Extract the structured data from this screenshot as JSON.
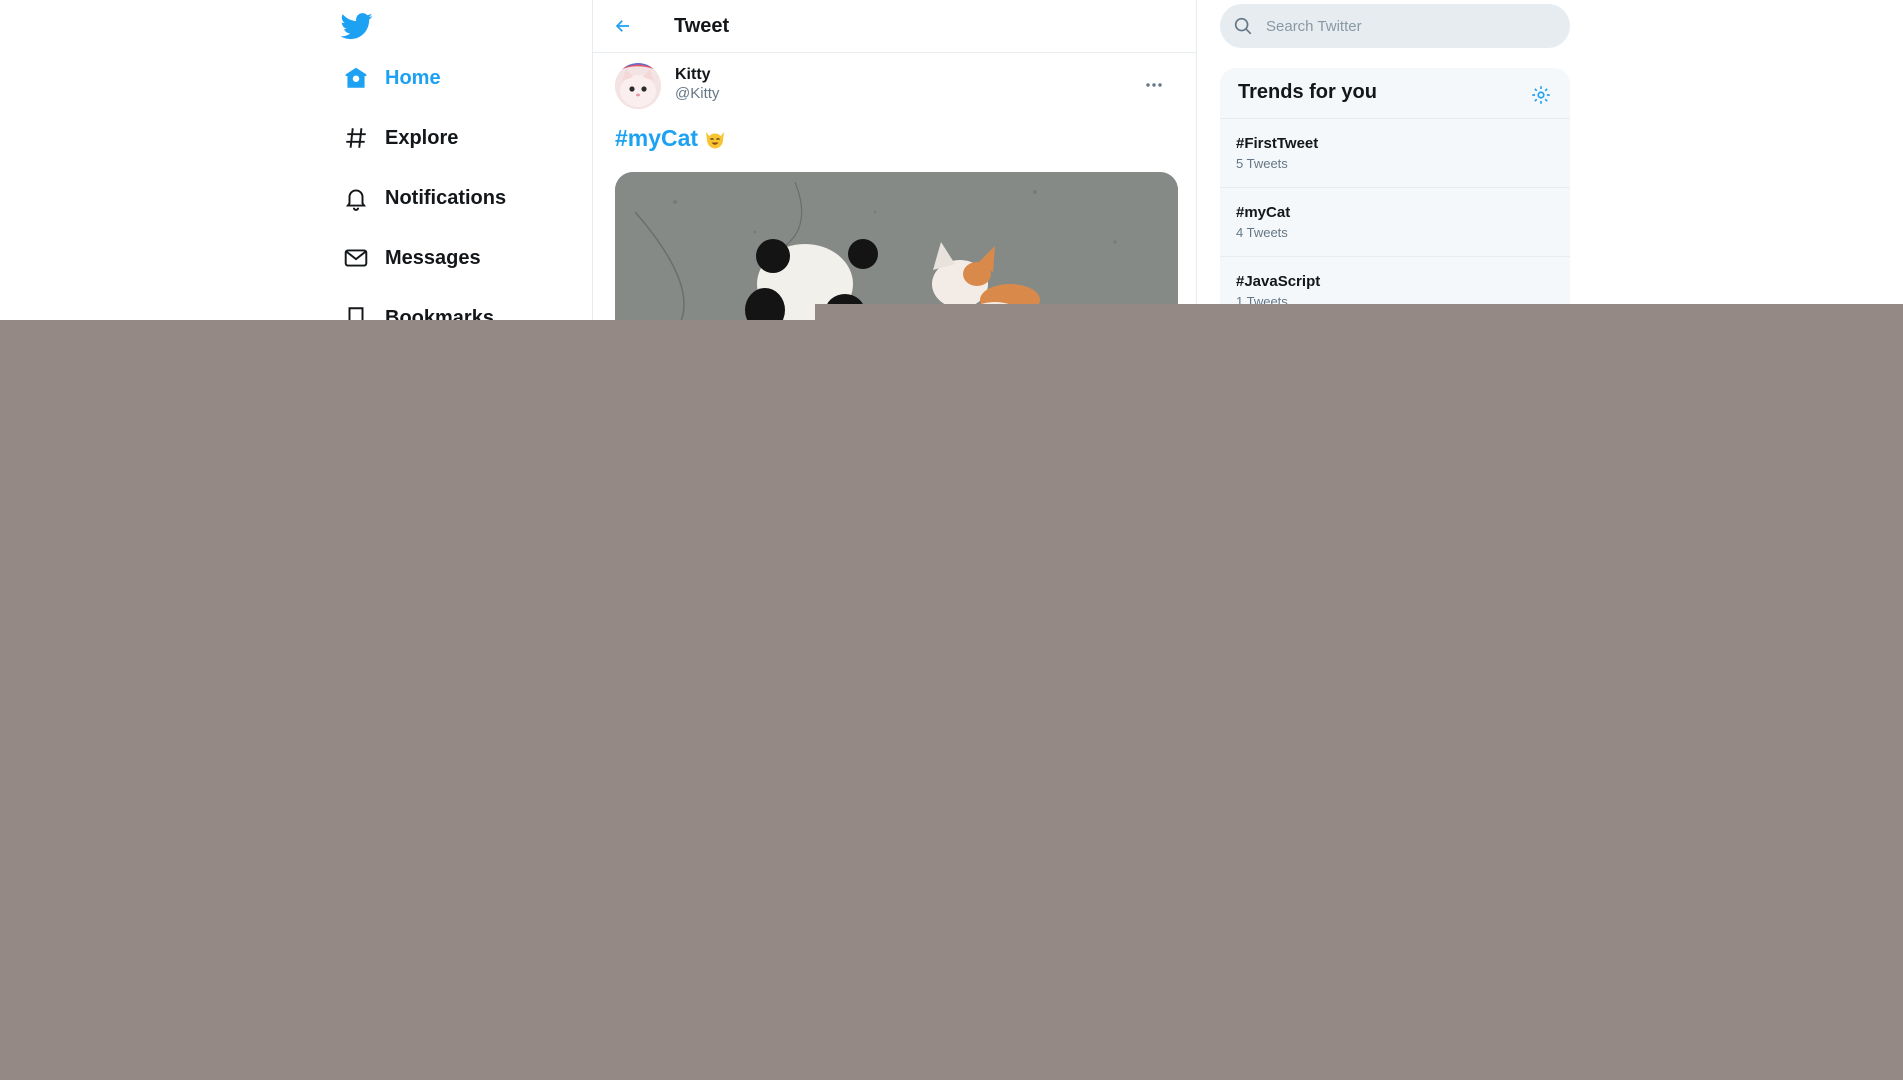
{
  "nav": {
    "items": [
      {
        "label": "Home",
        "icon": "home-icon",
        "active": true
      },
      {
        "label": "Explore",
        "icon": "hashtag-icon",
        "active": false
      },
      {
        "label": "Notifications",
        "icon": "bell-icon",
        "active": false
      },
      {
        "label": "Messages",
        "icon": "envelope-icon",
        "active": false
      },
      {
        "label": "Bookmarks",
        "icon": "bookmark-icon",
        "active": false
      }
    ]
  },
  "header": {
    "title": "Tweet"
  },
  "tweet": {
    "author_name": "Kitty",
    "author_handle": "@Kitty",
    "hashtag": "#myCat",
    "emoji": "smiling-cat-emoji"
  },
  "search": {
    "placeholder": "Search Twitter"
  },
  "trends": {
    "title": "Trends for you",
    "items": [
      {
        "tag": "#FirstTweet",
        "count": "5 Tweets"
      },
      {
        "tag": "#myCat",
        "count": "4 Tweets"
      },
      {
        "tag": "#JavaScript",
        "count": "1 Tweets"
      }
    ]
  },
  "colors": {
    "accent": "#1da1f2",
    "text": "#14171a",
    "muted": "#657786",
    "overlay": "#958985"
  }
}
